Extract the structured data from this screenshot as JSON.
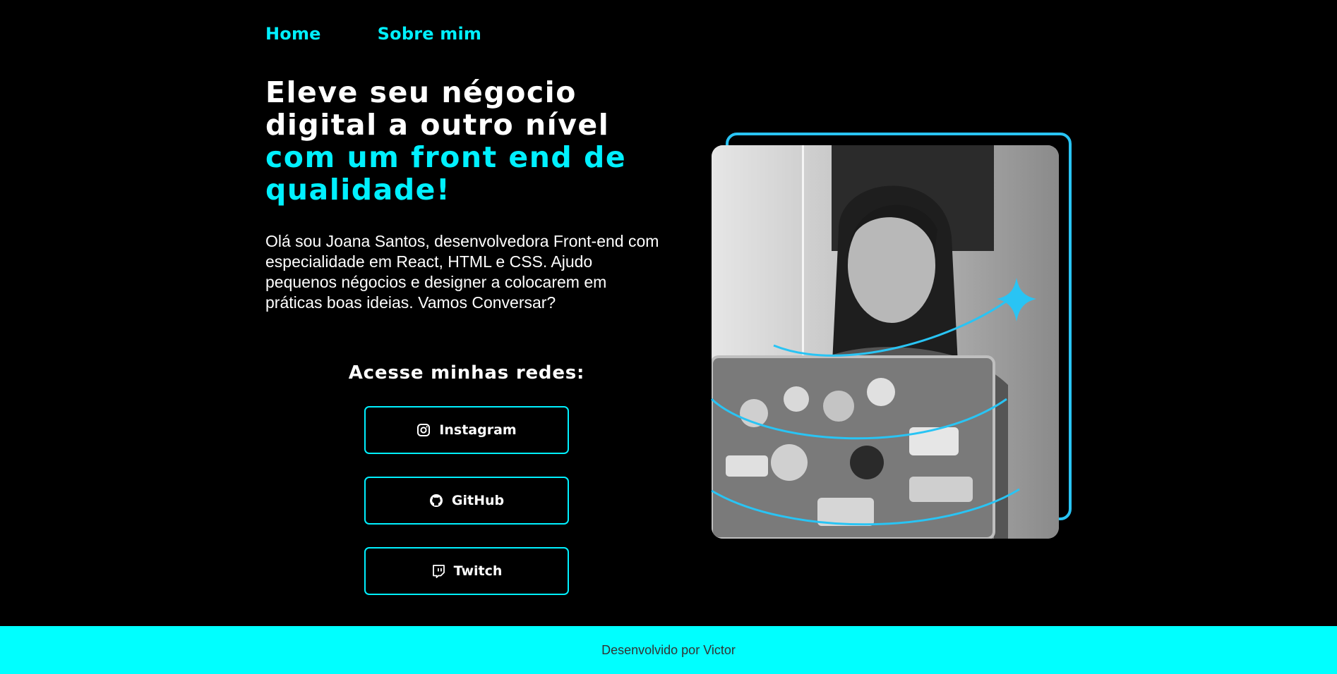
{
  "nav": {
    "items": [
      {
        "label": "Home"
      },
      {
        "label": "Sobre mim"
      }
    ]
  },
  "hero": {
    "title_plain": "Eleve seu négocio digital a outro nível ",
    "title_accent": "com um front end de qualidade!",
    "intro": "Olá sou Joana Santos, desenvolvedora Front-end com especialidade em React, HTML e CSS. Ajudo pequenos négocios e designer a colocarem em práticas boas ideias. Vamos Conversar?"
  },
  "social": {
    "heading": "Acesse minhas redes:",
    "buttons": [
      {
        "label": "Instagram",
        "icon": "instagram-icon"
      },
      {
        "label": "GitHub",
        "icon": "github-icon"
      },
      {
        "label": "Twitch",
        "icon": "twitch-icon"
      }
    ]
  },
  "footer": {
    "text": "Desenvolvido por Victor"
  },
  "colors": {
    "accent": "#00f0ff",
    "footer_bg": "#00ffff",
    "decor": "#29c4f4",
    "background": "#000000"
  }
}
